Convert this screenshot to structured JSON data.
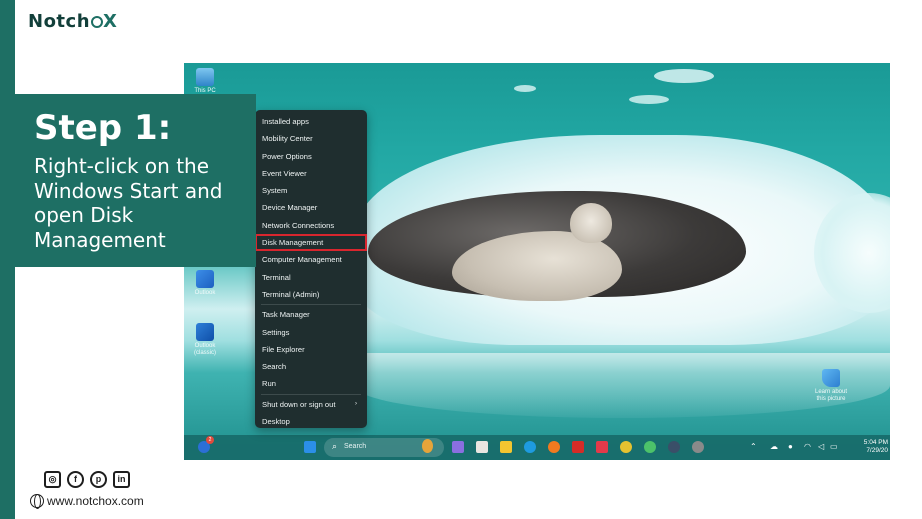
{
  "brand": {
    "name_prefix": "Notch",
    "name_x": "X"
  },
  "step": {
    "title": "Step 1:",
    "text": "Right-click on the Windows Start and open Disk Management"
  },
  "desktop": {
    "icons": [
      {
        "label": "This PC"
      },
      {
        "label": "Outlook"
      },
      {
        "label": "Outlook (classic)"
      }
    ],
    "spotlight": {
      "label": "Learn about this picture"
    }
  },
  "context_menu": {
    "items": [
      {
        "label": "Installed apps"
      },
      {
        "label": "Mobility Center"
      },
      {
        "label": "Power Options"
      },
      {
        "label": "Event Viewer"
      },
      {
        "label": "System"
      },
      {
        "label": "Device Manager"
      },
      {
        "label": "Network Connections"
      },
      {
        "label": "Disk Management",
        "highlight_color": "#d8262e"
      },
      {
        "label": "Computer Management"
      },
      {
        "label": "Terminal"
      },
      {
        "label": "Terminal (Admin)"
      },
      {
        "label": "Task Manager"
      },
      {
        "label": "Settings"
      },
      {
        "label": "File Explorer"
      },
      {
        "label": "Search"
      },
      {
        "label": "Run"
      },
      {
        "label": "Shut down or sign out",
        "submenu_arrow": "›"
      },
      {
        "label": "Desktop"
      }
    ]
  },
  "taskbar": {
    "search_placeholder": "Search",
    "time": "5:04 PM",
    "date": "7/29/20",
    "widgets_badge": "2"
  },
  "footer": {
    "website": "www.notchox.com",
    "social": [
      "instagram-icon",
      "facebook-icon",
      "pinterest-icon",
      "linkedin-icon"
    ]
  },
  "colors": {
    "brand_green": "#1e6f64",
    "highlight_red": "#d8262e",
    "menu_bg": "#1f2e2f"
  }
}
